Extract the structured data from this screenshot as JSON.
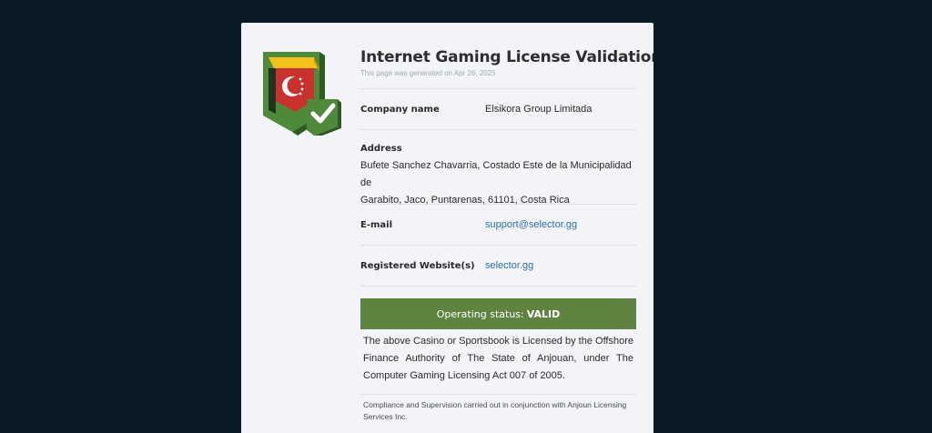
{
  "title": "Internet Gaming License Validation",
  "generated_text": "This page was generated on Apr 26, 2025",
  "company": {
    "label": "Company name",
    "value": "Elsikora Group Limitada"
  },
  "address": {
    "label": "Address",
    "line1": "Bufete Sanchez Chavarria, Costado Este de la Municipalidad de",
    "line2": "Garabito, Jaco, Puntarenas, 61101, Costa Rica"
  },
  "email": {
    "label": "E-mail",
    "value": "support@selector.gg"
  },
  "website": {
    "label": "Registered Website(s)",
    "value": "selector.gg"
  },
  "status": {
    "prefix": "Operating status:",
    "value": "VALID",
    "color": "#5f8340"
  },
  "license_text": "The above Casino or Sportsbook is Licensed by the Offshore Finance Authority of The State of Anjouan, under The Computer Gaming Licensing Act 007 of 2005.",
  "footnote": "Compliance and Supervision carried out in conjunction with Anjoun Licensing Services Inc.",
  "seal": {
    "icon": "license-seal-checkmark-icon",
    "colors": {
      "green": "#4f8a3a",
      "yellow": "#f2c21b",
      "red": "#c8312d",
      "dark": "#1f3320"
    }
  }
}
